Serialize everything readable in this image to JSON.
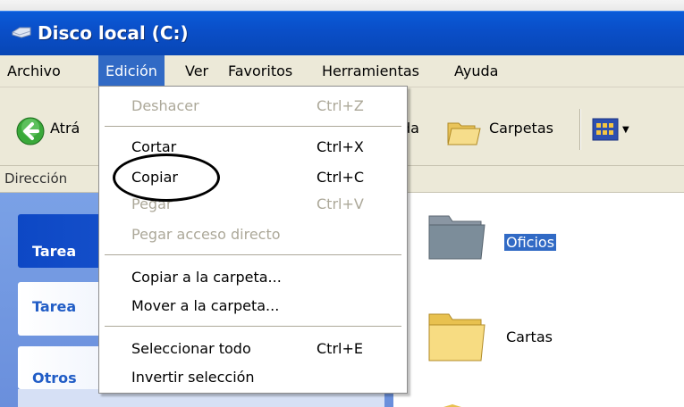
{
  "window": {
    "title": "Disco local (C:)",
    "title_icon": "drive-icon"
  },
  "menubar": {
    "items": [
      {
        "label": "Archivo"
      },
      {
        "label": "Edición"
      },
      {
        "label": "Ver"
      },
      {
        "label": "Favoritos"
      },
      {
        "label": "Herramientas"
      },
      {
        "label": "Ayuda"
      }
    ],
    "active_index": 1
  },
  "toolbar": {
    "back_label": "Atrá",
    "search_label_tail": "da",
    "folders_label": "Carpetas",
    "views_icon": "views-icon"
  },
  "address": {
    "label": "Dirección"
  },
  "taskpane": {
    "cards": [
      {
        "title": "Tarea"
      },
      {
        "title": "Tarea"
      },
      {
        "title": "Otros"
      }
    ]
  },
  "files": [
    {
      "name": "Oficios",
      "selected": true
    },
    {
      "name": "Cartas",
      "selected": false
    }
  ],
  "edit_menu": {
    "items": [
      {
        "label": "Deshacer",
        "shortcut": "Ctrl+Z",
        "enabled": false
      },
      {
        "label": "Cortar",
        "shortcut": "Ctrl+X",
        "enabled": true
      },
      {
        "label": "Copiar",
        "shortcut": "Ctrl+C",
        "enabled": true
      },
      {
        "label": "Pegar",
        "shortcut": "Ctrl+V",
        "enabled": false
      },
      {
        "label": "Pegar acceso directo",
        "shortcut": "",
        "enabled": false
      },
      {
        "label": "Copiar a la carpeta...",
        "shortcut": "",
        "enabled": true
      },
      {
        "label": "Mover a la carpeta...",
        "shortcut": "",
        "enabled": true
      },
      {
        "label": "Seleccionar todo",
        "shortcut": "Ctrl+E",
        "enabled": true
      },
      {
        "label": "Invertir selección",
        "shortcut": "",
        "enabled": true
      }
    ]
  },
  "colors": {
    "titlebar": "#0a4fc9",
    "menu_highlight": "#316ac5",
    "disabled_text": "#aca899",
    "taskpane": "#7aa1e6",
    "folder": "#f4d06a"
  }
}
